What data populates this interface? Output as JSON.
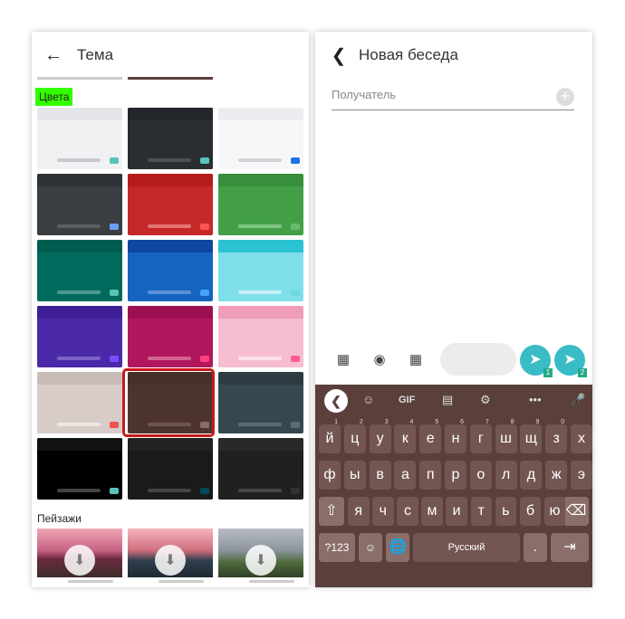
{
  "left": {
    "title": "Тема",
    "section_colors": "Цвета",
    "section_landscapes": "Пейзажи",
    "tiles": [
      {
        "bg": "#f0f1f3",
        "top": "#e4e6e9",
        "bar": "#c7c9cc",
        "btn": "#57c4b7"
      },
      {
        "bg": "#2a2e33",
        "top": "#23272b",
        "bar": "#4b5056",
        "btn": "#57c4b7"
      },
      {
        "bg": "#f7f7f9",
        "top": "#ebedf0",
        "bar": "#d0d3d6",
        "btn": "#1b73e8"
      },
      {
        "bg": "#3a3d42",
        "top": "#2f3236",
        "bar": "#5a5e63",
        "btn": "#6c9ef7"
      },
      {
        "bg": "#c62828",
        "top": "#b71c1c",
        "bar": "#e57373",
        "btn": "#ff5252"
      },
      {
        "bg": "#43a047",
        "top": "#388e3c",
        "bar": "#81c784",
        "btn": "#66bb6a"
      },
      {
        "bg": "#006b5c",
        "top": "#005c4e",
        "bar": "#4c9a8f",
        "btn": "#57c4b7"
      },
      {
        "bg": "#1565c0",
        "top": "#0d47a1",
        "bar": "#5b8fd6",
        "btn": "#42a5f5"
      },
      {
        "bg": "#7fdfe9",
        "top": "#2bc3d3",
        "bar": "#c6f0f5",
        "btn": "#6fd9e4"
      },
      {
        "bg": "#4a2aa8",
        "top": "#3f1f96",
        "bar": "#7b63c4",
        "btn": "#7c4dff"
      },
      {
        "bg": "#b0175d",
        "top": "#9c1050",
        "bar": "#d36393",
        "btn": "#ff4081"
      },
      {
        "bg": "#f6bdd0",
        "top": "#ef9dbb",
        "bar": "#fbe0ea",
        "btn": "#ff5b96"
      },
      {
        "bg": "#d7ccc8",
        "top": "#cabdb8",
        "bar": "#ede7e4",
        "btn": "#ef5350"
      },
      {
        "bg": "#4e342e",
        "top": "#45302a",
        "bar": "#6d544e",
        "btn": "#8d6e63"
      },
      {
        "bg": "#37474f",
        "top": "#2d3b42",
        "bar": "#5d6c73",
        "btn": "#546e7a"
      },
      {
        "bg": "#000000",
        "top": "#111111",
        "bar": "#444444",
        "btn": "#57c4b7"
      },
      {
        "bg": "#1a1a1a",
        "top": "#222222",
        "bar": "#444444",
        "btn": "#004b5c"
      },
      {
        "bg": "#202020",
        "top": "#292929",
        "bar": "#454545",
        "btn": "#333333"
      }
    ]
  },
  "right": {
    "title": "Новая беседа",
    "recipient_placeholder": "Получатель",
    "send1_badge": "1",
    "send2_badge": "2",
    "keyboard": {
      "gif": "GIF",
      "row1": [
        "й",
        "ц",
        "у",
        "к",
        "е",
        "н",
        "г",
        "ш",
        "щ",
        "з",
        "х"
      ],
      "row1_hints": [
        "1",
        "2",
        "3",
        "4",
        "5",
        "6",
        "7",
        "8",
        "9",
        "0",
        ""
      ],
      "row2": [
        "ф",
        "ы",
        "в",
        "а",
        "п",
        "р",
        "о",
        "л",
        "д",
        "ж",
        "э"
      ],
      "row3": [
        "я",
        "ч",
        "с",
        "м",
        "и",
        "т",
        "ь",
        "б",
        "ю"
      ],
      "sym": "?123",
      "space": "Русский",
      "period": "."
    }
  }
}
